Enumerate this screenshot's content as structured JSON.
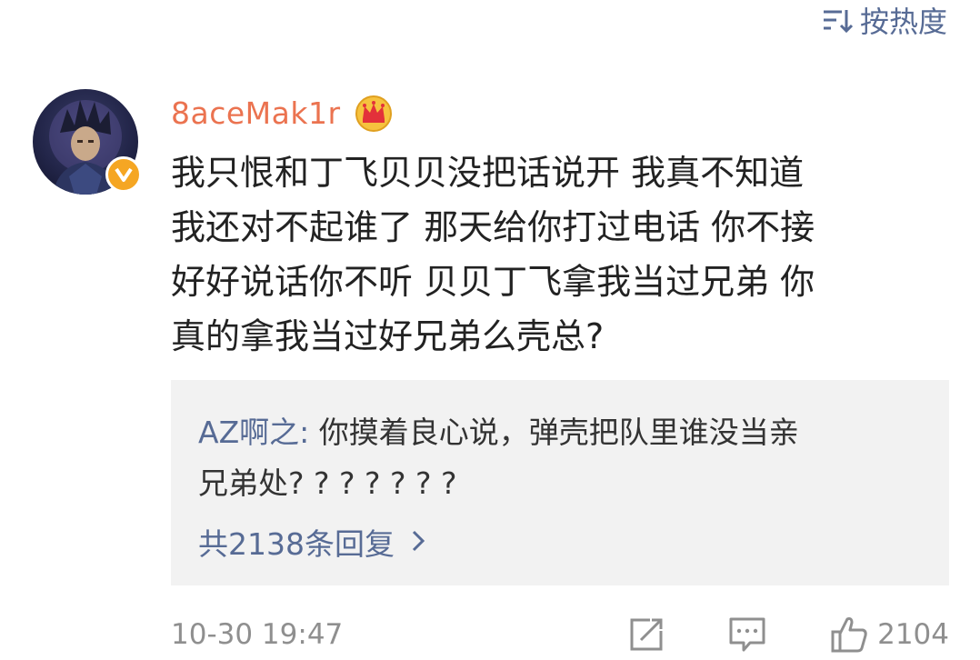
{
  "sort": {
    "icon": "sort-icon",
    "label": "按热度",
    "color": "#576b95"
  },
  "comment": {
    "avatar_icon": "avatar",
    "verified_icon": "verified-v-badge-icon",
    "username": "8aceMak1r",
    "username_color": "#eb7350",
    "member_icon": "crown-icon",
    "text": "我只恨和丁飞贝贝没把话说开 我真不知道\n我还对不起谁了 那天给你打过电话 你不接\n好好说话你不听 贝贝丁飞拿我当过兄弟 你\n真的拿我当过好兄弟么壳总?",
    "timestamp": "10-30 19:47",
    "like_count": "2104"
  },
  "reply": {
    "author": "AZ啊之:",
    "text": " 你摸着良心说，弹壳把队里谁没当亲\n兄弟处? ? ? ? ? ? ?",
    "more_label": "共2138条回复",
    "more_icon": "chevron-right-icon",
    "background": "#f2f2f2"
  },
  "actions": {
    "share_icon": "share-icon",
    "comment_icon": "comment-icon",
    "like_icon": "thumbs-up-icon"
  }
}
